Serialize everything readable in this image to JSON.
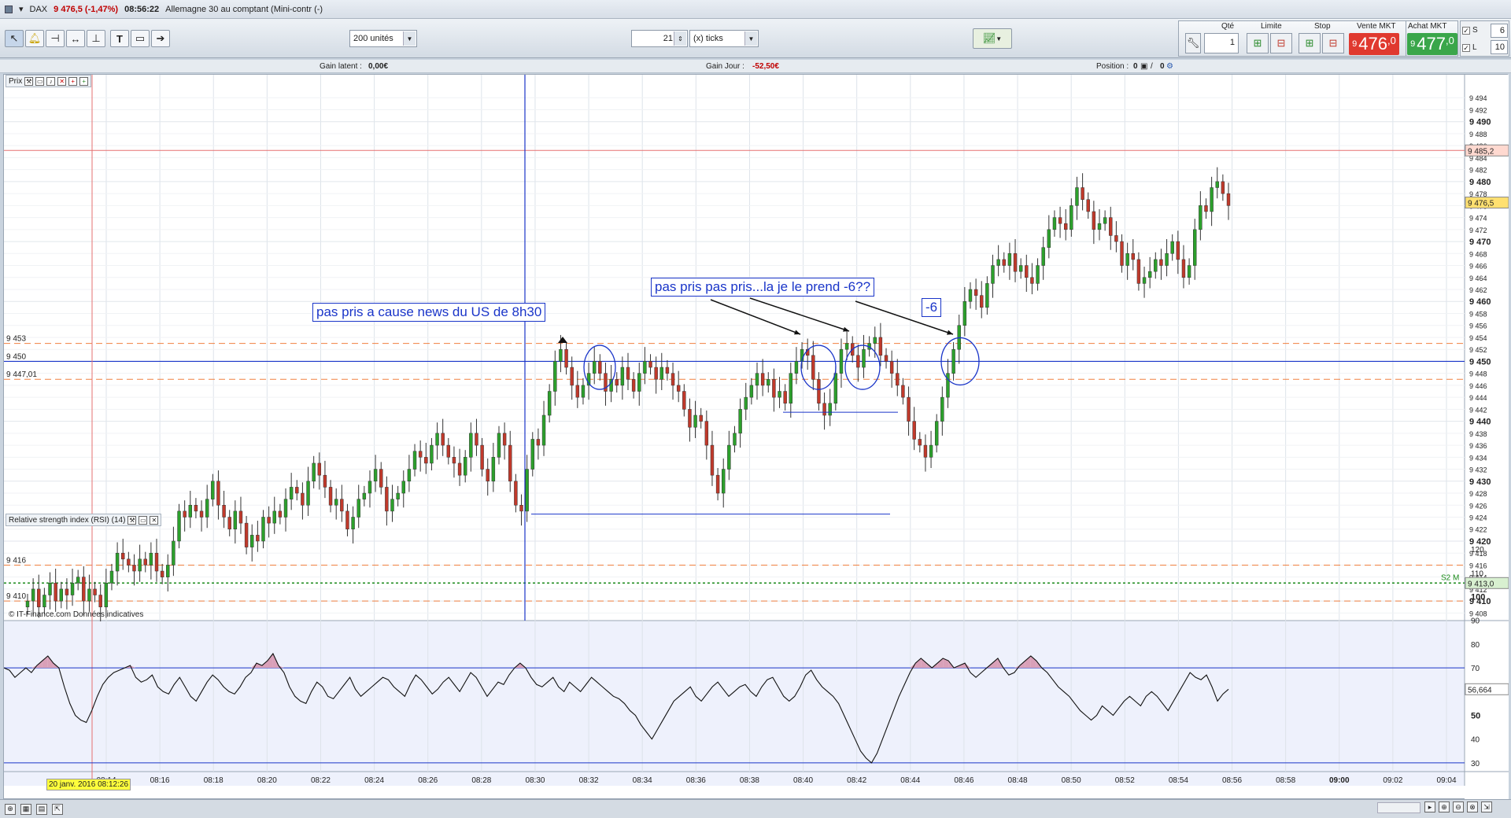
{
  "titlebar": {
    "symbol": "DAX",
    "price_change": "9 476,5 (-1,47%)",
    "time": "08:56:22",
    "instrument": "Allemagne 30 au comptant (Mini-contr (-)"
  },
  "toolbar": {
    "units_select": "200 unités",
    "ticks_value": "21",
    "ticks_select": "(x) ticks"
  },
  "order_panel": {
    "qty_label": "Qté",
    "qty_value": "1",
    "limit_label": "Limite",
    "stop_label": "Stop",
    "sell_label": "Vente MKT",
    "sell_prefix": "9",
    "sell_main": "476",
    "sell_dec": ",0",
    "buy_label": "Achat MKT",
    "buy_prefix": "9",
    "buy_main": "477",
    "buy_dec": ",0",
    "sell_color": "#e0392f",
    "buy_color": "#3aa64a"
  },
  "sl_panel": {
    "s_label": "S",
    "s_value": "6",
    "l_label": "L",
    "l_value": "10"
  },
  "infobar": {
    "gain_latent_label": "Gain latent :",
    "gain_latent": "0,00€",
    "gain_jour_label": "Gain Jour :",
    "gain_jour": "-52,50€",
    "position_label": "Position :",
    "position_a": "0",
    "position_b": "0"
  },
  "price_panel": {
    "title": "Prix"
  },
  "rsi_panel": {
    "title": "Relative strength index (RSI) (14)"
  },
  "copyright": "© IT-Finance.com Données indicatives",
  "date_highlight": "20 janv. 2016 08:12:26",
  "annotations": {
    "news": "pas pris a cause news du US de 8h30",
    "pris": "pas pris pas pris...la je le prend -6??",
    "minus6": "-6"
  },
  "left_levels": [
    {
      "label": "9 453",
      "y": 9453
    },
    {
      "label": "9 450",
      "y": 9450
    },
    {
      "label": "9 447,01",
      "y": 9447.01
    },
    {
      "label": "9 416",
      "y": 9416
    },
    {
      "label": "9 410",
      "y": 9410
    }
  ],
  "chart_data": [
    {
      "type": "candlestick",
      "title": "",
      "ylim": [
        9407,
        9496
      ],
      "y_ticks": [
        "9 408",
        "9 410",
        "9 412",
        "9 414",
        "9 416",
        "9 418",
        "9 420",
        "9 422",
        "9 424",
        "9 426",
        "9 428",
        "9 430",
        "9 432",
        "9 434",
        "9 436",
        "9 438",
        "9 440",
        "9 442",
        "9 444",
        "9 446",
        "9 448",
        "9 450",
        "9 452",
        "9 454",
        "9 456",
        "9 458",
        "9 460",
        "9 462",
        "9 464",
        "9 466",
        "9 468",
        "9 470",
        "9 472",
        "9 474",
        "9 476",
        "9 478",
        "9 480",
        "9 482",
        "9 484",
        "9 486",
        "9 488",
        "9 490",
        "9 492",
        "9 494"
      ],
      "x_ticks": [
        "08:14",
        "08:16",
        "08:18",
        "08:20",
        "08:22",
        "08:24",
        "08:26",
        "08:28",
        "08:30",
        "08:32",
        "08:34",
        "08:36",
        "08:38",
        "08:40",
        "08:42",
        "08:44",
        "08:46",
        "08:48",
        "08:50",
        "08:52",
        "08:54",
        "08:56",
        "08:58",
        "09:00",
        "09:02",
        "09:04"
      ],
      "tags": {
        "upper_line": "9 485,2",
        "last_price": "9 476,5",
        "pivot": "9 413,0",
        "pivot_name": "S2 M"
      },
      "levels": {
        "upper_red": 9485.2,
        "h_blue": 9450,
        "dashed_orange": [
          9453,
          9447.01,
          9416,
          9410
        ],
        "pivot_green": 9413
      },
      "colors": {
        "up": "#2ca02c",
        "down": "#c0392b",
        "blue": "#1a35c9",
        "orange": "#f08040",
        "green": "#1a8a1a"
      },
      "closes": [
        9410,
        9412,
        9409,
        9411,
        9413,
        9410,
        9412,
        9411,
        9413,
        9414,
        9410,
        9412,
        9411,
        9409,
        9413,
        9415,
        9418,
        9417,
        9416,
        9415,
        9417,
        9416,
        9418,
        9415,
        9414,
        9416,
        9420,
        9425,
        9424,
        9426,
        9425,
        9424,
        9427,
        9430,
        9426,
        9424,
        9422,
        9425,
        9423,
        9419,
        9421,
        9420,
        9424,
        9423,
        9425,
        9424,
        9427,
        9429,
        9428,
        9426,
        9430,
        9433,
        9431,
        9429,
        9426,
        9427,
        9425,
        9422,
        9424,
        9427,
        9428,
        9430,
        9432,
        9429,
        9425,
        9427,
        9428,
        9430,
        9432,
        9435,
        9434,
        9433,
        9436,
        9438,
        9436,
        9434,
        9433,
        9431,
        9434,
        9438,
        9436,
        9432,
        9430,
        9434,
        9438,
        9436,
        9430,
        9426,
        9425,
        9432,
        9437,
        9436,
        9441,
        9445,
        9450,
        9452,
        9449,
        9446,
        9444,
        9446,
        9448,
        9450,
        9448,
        9445,
        9447,
        9446,
        9449,
        9447,
        9445,
        9448,
        9450,
        9449,
        9447,
        9449,
        9448,
        9446,
        9445,
        9442,
        9439,
        9441,
        9440,
        9436,
        9431,
        9428,
        9432,
        9436,
        9438,
        9442,
        9444,
        9446,
        9448,
        9446,
        9447,
        9444,
        9445,
        9443,
        9448,
        9450,
        9452,
        9451,
        9447,
        9443,
        9441,
        9443,
        9448,
        9452,
        9453,
        9451,
        9449,
        9452,
        9453,
        9454,
        9451,
        9450,
        9448,
        9446,
        9444,
        9440,
        9437,
        9436,
        9434,
        9436,
        9440,
        9444,
        9448,
        9452,
        9456,
        9460,
        9462,
        9461,
        9459,
        9463,
        9466,
        9467,
        9466,
        9468,
        9465,
        9466,
        9464,
        9463,
        9466,
        9469,
        9472,
        9474,
        9473,
        9472,
        9476,
        9479,
        9477,
        9475,
        9472,
        9473,
        9474,
        9471,
        9470,
        9466,
        9468,
        9467,
        9463,
        9464,
        9465,
        9467,
        9466,
        9468,
        9470,
        9467,
        9464,
        9466,
        9472,
        9476,
        9475,
        9479,
        9480,
        9478,
        9476
      ]
    },
    {
      "type": "line",
      "title": "Relative strength index (RSI) (14)",
      "ylim": [
        25,
        125
      ],
      "y_ticks": [
        "120",
        "110",
        "100",
        "90",
        "80",
        "70",
        "60",
        "50",
        "40",
        "30"
      ],
      "bands": [
        30,
        70
      ],
      "last_value": "56,664",
      "values": [
        70,
        69,
        66,
        68,
        70,
        68,
        71,
        73,
        75,
        72,
        70,
        62,
        55,
        50,
        48,
        47,
        52,
        58,
        63,
        66,
        68,
        69,
        70,
        71,
        66,
        64,
        65,
        67,
        62,
        60,
        59,
        63,
        66,
        62,
        58,
        56,
        60,
        64,
        67,
        65,
        62,
        60,
        59,
        62,
        66,
        68,
        72,
        71,
        73,
        76,
        71,
        68,
        62,
        58,
        56,
        55,
        60,
        64,
        62,
        58,
        57,
        60,
        63,
        66,
        61,
        58,
        60,
        62,
        64,
        66,
        65,
        62,
        60,
        58,
        63,
        67,
        65,
        62,
        59,
        61,
        64,
        66,
        63,
        60,
        64,
        68,
        66,
        62,
        58,
        61,
        64,
        63,
        67,
        70,
        72,
        70,
        66,
        63,
        62,
        64,
        66,
        62,
        60,
        64,
        62,
        60,
        63,
        66,
        64,
        62,
        60,
        58,
        57,
        55,
        52,
        50,
        46,
        43,
        40,
        44,
        48,
        52,
        56,
        58,
        60,
        62,
        58,
        56,
        59,
        62,
        64,
        61,
        58,
        60,
        62,
        63,
        60,
        58,
        62,
        65,
        66,
        62,
        58,
        56,
        58,
        62,
        67,
        69,
        65,
        62,
        60,
        58,
        55,
        50,
        45,
        40,
        35,
        32,
        30,
        34,
        40,
        46,
        52,
        58,
        63,
        68,
        72,
        74,
        72,
        70,
        72,
        74,
        73,
        70,
        71,
        72,
        68,
        66,
        68,
        70,
        72,
        74,
        70,
        67,
        68,
        71,
        73,
        75,
        73,
        70,
        68,
        65,
        62,
        60,
        58,
        55,
        52,
        50,
        48,
        50,
        54,
        52,
        50,
        53,
        56,
        58,
        56,
        54,
        58,
        60,
        58,
        55,
        52,
        56,
        60,
        64,
        68,
        66,
        65,
        67,
        62,
        56,
        59,
        61
      ]
    }
  ]
}
